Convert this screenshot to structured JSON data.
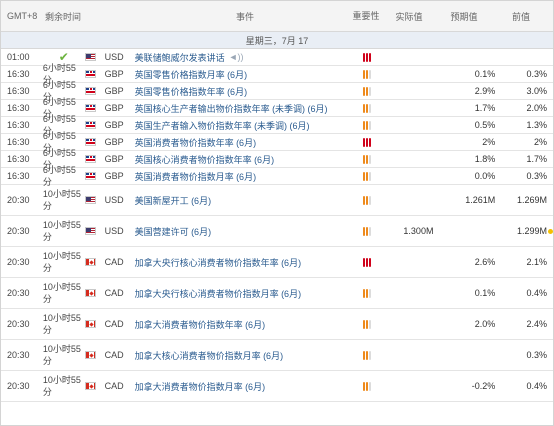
{
  "header": {
    "tz": "GMT+8",
    "remaining": "剩余时间",
    "event": "事件",
    "importance": "重要性",
    "actual": "实际值",
    "forecast": "预期值",
    "previous": "前值"
  },
  "date_label": "星期三，7月 17",
  "colors": {
    "high": "#d0021b",
    "medium": "#ee8a1c",
    "link": "#2a5b8f",
    "checkmark": "#6cb33e"
  },
  "rows": [
    {
      "time": "01:00",
      "remaining": "",
      "done": true,
      "flag": "usd",
      "currency": "USD",
      "event": "美联储鲍威尔发表讲话",
      "speech": true,
      "importance": "high",
      "actual": "",
      "forecast": "",
      "previous": "",
      "marker": false
    },
    {
      "time": "16:30",
      "remaining": "6小时55分",
      "done": false,
      "flag": "gbp",
      "currency": "GBP",
      "event": "英国零售价格指数月率 (6月)",
      "speech": false,
      "importance": "medium",
      "actual": "",
      "forecast": "0.1%",
      "previous": "0.3%",
      "marker": false
    },
    {
      "time": "16:30",
      "remaining": "6小时55分",
      "done": false,
      "flag": "gbp",
      "currency": "GBP",
      "event": "英国零售价格指数年率 (6月)",
      "speech": false,
      "importance": "medium",
      "actual": "",
      "forecast": "2.9%",
      "previous": "3.0%",
      "marker": false
    },
    {
      "time": "16:30",
      "remaining": "6小时55分",
      "done": false,
      "flag": "gbp",
      "currency": "GBP",
      "event": "英国核心生产者输出物价指数年率 (未季调) (6月)",
      "speech": false,
      "importance": "medium",
      "actual": "",
      "forecast": "1.7%",
      "previous": "2.0%",
      "marker": false
    },
    {
      "time": "16:30",
      "remaining": "6小时55分",
      "done": false,
      "flag": "gbp",
      "currency": "GBP",
      "event": "英国生产者输入物价指数年率 (未季调) (6月)",
      "speech": false,
      "importance": "medium",
      "actual": "",
      "forecast": "0.5%",
      "previous": "1.3%",
      "marker": false
    },
    {
      "time": "16:30",
      "remaining": "6小时55分",
      "done": false,
      "flag": "gbp",
      "currency": "GBP",
      "event": "英国消费者物价指数年率 (6月)",
      "speech": false,
      "importance": "high",
      "actual": "",
      "forecast": "2%",
      "previous": "2%",
      "marker": false
    },
    {
      "time": "16:30",
      "remaining": "6小时55分",
      "done": false,
      "flag": "gbp",
      "currency": "GBP",
      "event": "英国核心消费者物价指数年率 (6月)",
      "speech": false,
      "importance": "medium",
      "actual": "",
      "forecast": "1.8%",
      "previous": "1.7%",
      "marker": false
    },
    {
      "time": "16:30",
      "remaining": "6小时55分",
      "done": false,
      "flag": "gbp",
      "currency": "GBP",
      "event": "英国消费者物价指数月率 (6月)",
      "speech": false,
      "importance": "medium",
      "actual": "",
      "forecast": "0.0%",
      "previous": "0.3%",
      "marker": false
    },
    {
      "time": "20:30",
      "remaining": "10小时55分",
      "done": false,
      "flag": "usd",
      "currency": "USD",
      "event": "美国新屋开工 (6月)",
      "speech": false,
      "importance": "medium",
      "actual": "",
      "forecast": "1.261M",
      "previous": "1.269M",
      "marker": false
    },
    {
      "time": "20:30",
      "remaining": "10小时55分",
      "done": false,
      "flag": "usd",
      "currency": "USD",
      "event": "美国营建许可 (6月)",
      "speech": false,
      "importance": "medium",
      "actual": "1.300M",
      "forecast": "",
      "previous": "1.299M",
      "marker": true
    },
    {
      "time": "20:30",
      "remaining": "10小时55分",
      "done": false,
      "flag": "cad",
      "currency": "CAD",
      "event": "加拿大央行核心消费者物价指数年率 (6月)",
      "speech": false,
      "importance": "high",
      "actual": "",
      "forecast": "2.6%",
      "previous": "2.1%",
      "marker": false
    },
    {
      "time": "20:30",
      "remaining": "10小时55分",
      "done": false,
      "flag": "cad",
      "currency": "CAD",
      "event": "加拿大央行核心消费者物价指数月率 (6月)",
      "speech": false,
      "importance": "medium",
      "actual": "",
      "forecast": "0.1%",
      "previous": "0.4%",
      "marker": false
    },
    {
      "time": "20:30",
      "remaining": "10小时55分",
      "done": false,
      "flag": "cad",
      "currency": "CAD",
      "event": "加拿大消费者物价指数年率 (6月)",
      "speech": false,
      "importance": "medium",
      "actual": "",
      "forecast": "2.0%",
      "previous": "2.4%",
      "marker": false
    },
    {
      "time": "20:30",
      "remaining": "10小时55分",
      "done": false,
      "flag": "cad",
      "currency": "CAD",
      "event": "加拿大核心消费者物价指数月率 (6月)",
      "speech": false,
      "importance": "medium",
      "actual": "",
      "forecast": "",
      "previous": "0.3%",
      "marker": false
    },
    {
      "time": "20:30",
      "remaining": "10小时55分",
      "done": false,
      "flag": "cad",
      "currency": "CAD",
      "event": "加拿大消费者物价指数月率 (6月)",
      "speech": false,
      "importance": "medium",
      "actual": "",
      "forecast": "-0.2%",
      "previous": "0.4%",
      "marker": false
    }
  ]
}
